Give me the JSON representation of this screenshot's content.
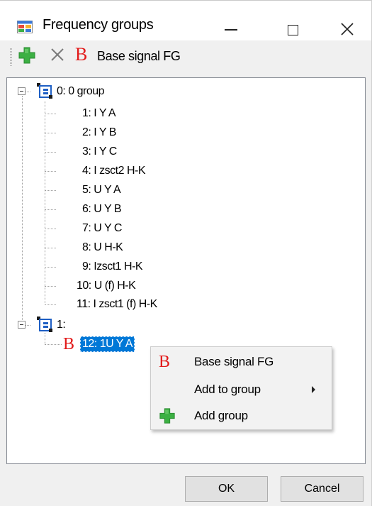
{
  "window": {
    "title": "Frequency groups"
  },
  "toolbar": {
    "base_signal_b": "B",
    "base_signal_label": "Base signal FG"
  },
  "tree": {
    "groups": [
      {
        "label": "0:  0 group",
        "items": [
          "1:  I Y A",
          "2:  I Y B",
          "3:  I Y C",
          "4:  I zsct2 H-K",
          "5:  U Y A",
          "6:  U Y B",
          "7:  U Y C",
          "8:  U H-K",
          "9:  Izsct1 H-K",
          "10:  U (f) H-K",
          "11:  I zsct1 (f) H-K"
        ]
      },
      {
        "label": "1:",
        "items": [
          "12:  1U Y A"
        ]
      }
    ],
    "selected_marker": "B"
  },
  "context_menu": {
    "items": [
      {
        "icon": "B",
        "label": "Base signal FG"
      },
      {
        "label": "Add to group"
      },
      {
        "label": "Add group"
      }
    ]
  },
  "buttons": {
    "ok": "OK",
    "cancel": "Cancel"
  },
  "colors": {
    "selection": "#0078d7",
    "base_signal_red": "#e21a1a",
    "add_green": "#3cb043"
  }
}
